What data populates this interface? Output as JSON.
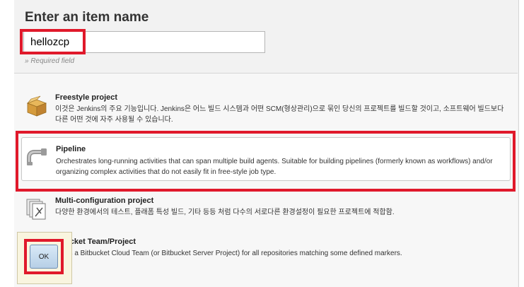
{
  "form": {
    "title": "Enter an item name",
    "item_name": "hellozcp",
    "required_note": "» Required field"
  },
  "items": [
    {
      "title": "Freestyle project",
      "description": "이것은 Jenkins의 주요 기능입니다. Jenkins은 어느 빌드 시스템과 어떤 SCM(형상관리)으로 묶인 당신의 프로젝트를 빌드할 것이고, 소프트웨어 빌드보다 다른 어떤 것에 자주 사용될 수 있습니다.",
      "icon": "freestyle-box-icon"
    },
    {
      "title": "Pipeline",
      "description": "Orchestrates long-running activities that can span multiple build agents. Suitable for building pipelines (formerly known as workflows) and/or organizing complex activities that do not easily fit in free-style job type.",
      "icon": "pipeline-icon",
      "selected": true
    },
    {
      "title": "Multi-configuration project",
      "description": "다양한 환경에서의 테스트, 플래폼 특성 빌드, 기타 등등 처럼 다수의 서로다른 환경설정이 필요한 프로젝트에 적합함.",
      "icon": "multi-config-icon"
    },
    {
      "title": "ucket Team/Project",
      "description": "ns a Bitbucket Cloud Team (or Bitbucket Server Project) for all repositories matching some defined markers.",
      "icon": "bitbucket-icon"
    }
  ],
  "ok_label": "OK",
  "colors": {
    "highlight": "#e0192b",
    "background": "#f2f2f2",
    "ok_button": "#c6dcf0"
  }
}
